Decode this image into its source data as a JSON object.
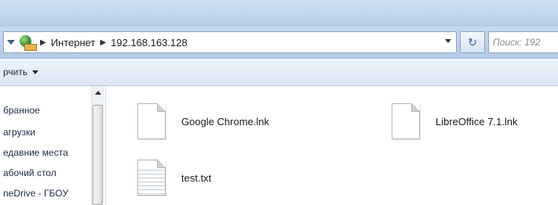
{
  "address_bar": {
    "breadcrumbs": [
      "Интернет",
      "192.168.163.128"
    ],
    "refresh_glyph": "↻",
    "search_placeholder": "Поиск: 192"
  },
  "toolbar": {
    "organize_label": "рчить"
  },
  "nav_pane": {
    "items": [
      {
        "label": "бранное"
      },
      {
        "label": "агрузки"
      },
      {
        "label": "едавние места"
      },
      {
        "label": "абочий стол"
      },
      {
        "label": "neDrive - ГБОУ"
      }
    ]
  },
  "files": [
    {
      "name": "Google Chrome.lnk",
      "icon": "shortcut-file-icon"
    },
    {
      "name": "LibreOffice 7.1.lnk",
      "icon": "shortcut-file-icon"
    },
    {
      "name": "test.txt",
      "icon": "text-file-icon"
    }
  ],
  "colors": {
    "chrome_blue": "#b7cde6",
    "toolbar": "#dce7f4",
    "background": "#ffffff"
  }
}
